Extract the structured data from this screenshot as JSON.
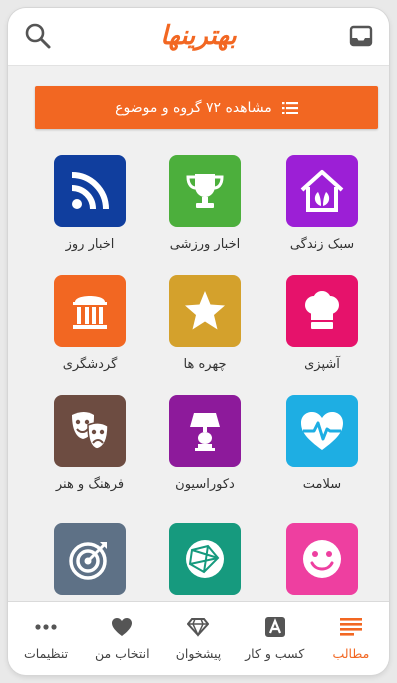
{
  "header": {
    "logo_text": "بهترینها",
    "search_icon": "search-icon",
    "inbox_icon": "inbox-icon"
  },
  "banner": {
    "label": "مشاهده ۷۲ گروه و موضوع",
    "icon": "list-icon"
  },
  "categories": [
    {
      "label": "سبک زندگی",
      "icon": "home-leaf-icon",
      "color": "#9c1fd6"
    },
    {
      "label": "اخبار ورزشی",
      "icon": "trophy-icon",
      "color": "#4caf3c"
    },
    {
      "label": "اخبار روز",
      "icon": "rss-icon",
      "color": "#103e9e"
    },
    {
      "label": "آشپزی",
      "icon": "chef-hat-icon",
      "color": "#e6126b"
    },
    {
      "label": "چهره ها",
      "icon": "star-icon",
      "color": "#d4a12c"
    },
    {
      "label": "گردشگری",
      "icon": "museum-icon",
      "color": "#f26722"
    },
    {
      "label": "سلامت",
      "icon": "heart-pulse-icon",
      "color": "#1eaee3"
    },
    {
      "label": "دکوراسیون",
      "icon": "lamp-icon",
      "color": "#8d1a9b"
    },
    {
      "label": "فرهنگ و هنر",
      "icon": "theater-masks-icon",
      "color": "#6d4c41"
    },
    {
      "label": "",
      "icon": "smiley-icon",
      "color": "#ee3fa0"
    },
    {
      "label": "",
      "icon": "globe-network-icon",
      "color": "#169a7e"
    },
    {
      "label": "",
      "icon": "target-icon",
      "color": "#5e7186"
    }
  ],
  "tabbar": {
    "tabs": [
      {
        "label": "مطالب",
        "icon": "list-lines-icon",
        "active": true
      },
      {
        "label": "کسب و کار",
        "icon": "letter-a-icon",
        "active": false
      },
      {
        "label": "پیشخوان",
        "icon": "diamond-icon",
        "active": false
      },
      {
        "label": "انتخاب من",
        "icon": "heart-icon",
        "active": false
      },
      {
        "label": "تنظیمات",
        "icon": "more-dots-icon",
        "active": false
      }
    ]
  },
  "colors": {
    "accent": "#f26722",
    "background": "#f0f0f0",
    "tab_icon": "#555555"
  }
}
